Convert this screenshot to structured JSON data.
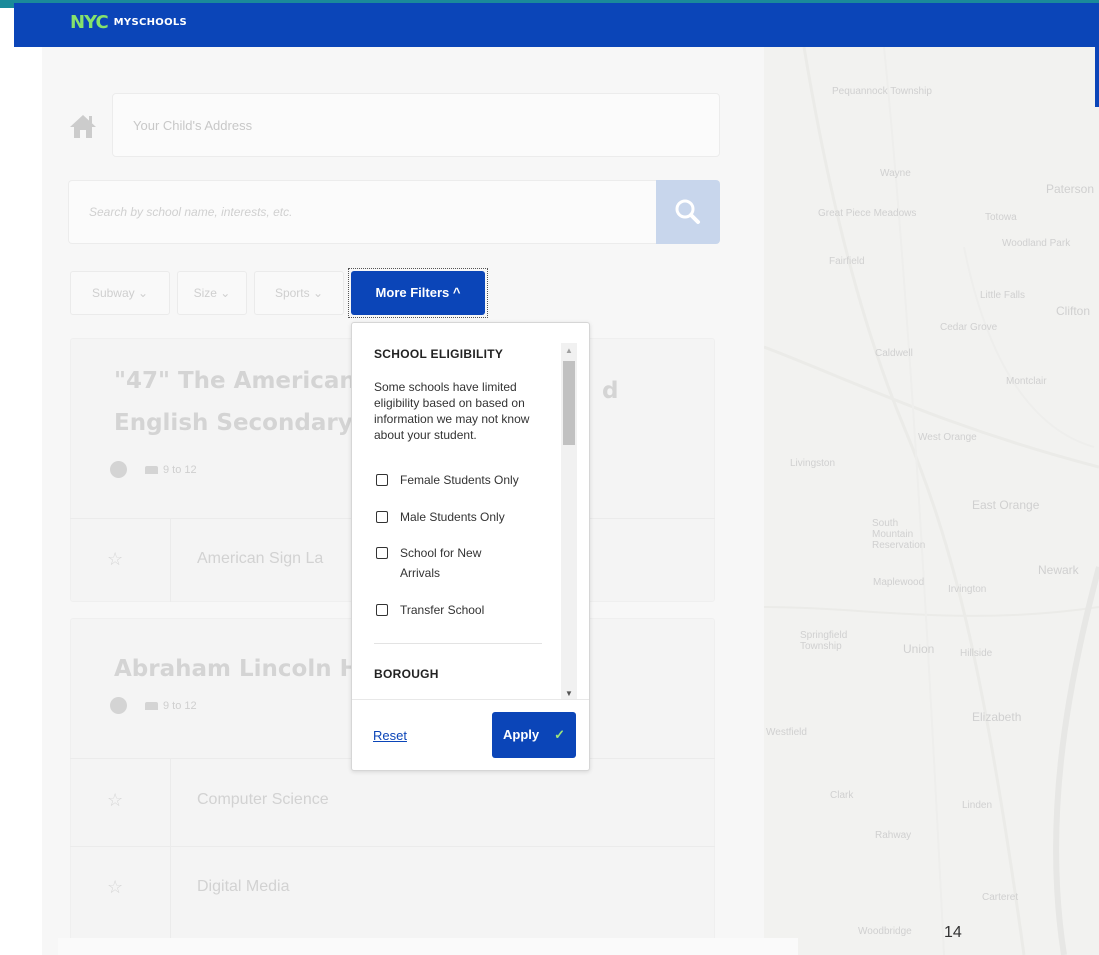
{
  "header": {
    "logo_nyc": "NYC",
    "logo_text": "MYSCHOOLS"
  },
  "search": {
    "address_placeholder": "Your Child's Address",
    "query_placeholder": "Search by school name, interests, etc."
  },
  "filters": {
    "chips": [
      {
        "label": "Subway ⌄"
      },
      {
        "label": "Size ⌄"
      },
      {
        "label": "Sports ⌄"
      }
    ],
    "more_filters_label": "More Filters ^"
  },
  "schools": [
    {
      "title_line1": "\"47\" The American",
      "title_line1_tail": "d",
      "title_line2": "English Secondary",
      "grades": "9 to 12",
      "programs": [
        "American Sign La"
      ]
    },
    {
      "title_line1": "Abraham Lincoln H",
      "grades": "9 to 12",
      "programs": [
        "Computer Science",
        "Digital Media"
      ]
    }
  ],
  "popup": {
    "eligibility_title": "SCHOOL ELIGIBILITY",
    "eligibility_desc": "Some schools have limited eligibility based on based on information we may not know about your student.",
    "options": [
      {
        "label": "Female Students Only"
      },
      {
        "label": "Male Students Only"
      },
      {
        "label": "School for New Arrivals"
      },
      {
        "label": "Transfer School"
      }
    ],
    "borough_title": "BOROUGH",
    "reset_label": "Reset",
    "apply_label": "Apply",
    "apply_icon": "✓"
  },
  "map": {
    "labels": [
      {
        "text": "Pequannock Township"
      },
      {
        "text": "Wayne"
      },
      {
        "text": "Paterson"
      },
      {
        "text": "Great Piece Meadows"
      },
      {
        "text": "Totowa"
      },
      {
        "text": "Woodland Park"
      },
      {
        "text": "Fairfield"
      },
      {
        "text": "Little Falls"
      },
      {
        "text": "Clifton"
      },
      {
        "text": "Cedar Grove"
      },
      {
        "text": "Caldwell"
      },
      {
        "text": "Montclair"
      },
      {
        "text": "Livingston"
      },
      {
        "text": "West Orange"
      },
      {
        "text": "East Orange"
      },
      {
        "text": "South Mountain Reservation"
      },
      {
        "text": "Newark"
      },
      {
        "text": "Maplewood"
      },
      {
        "text": "Irvington"
      },
      {
        "text": "Springfield Township"
      },
      {
        "text": "Union"
      },
      {
        "text": "Hillside"
      },
      {
        "text": "Elizabeth"
      },
      {
        "text": "Westfield"
      },
      {
        "text": "Clark"
      },
      {
        "text": "Linden"
      },
      {
        "text": "Rahway"
      },
      {
        "text": "Carteret"
      },
      {
        "text": "Woodbridge"
      }
    ]
  },
  "footer": {
    "page_number": "14"
  }
}
